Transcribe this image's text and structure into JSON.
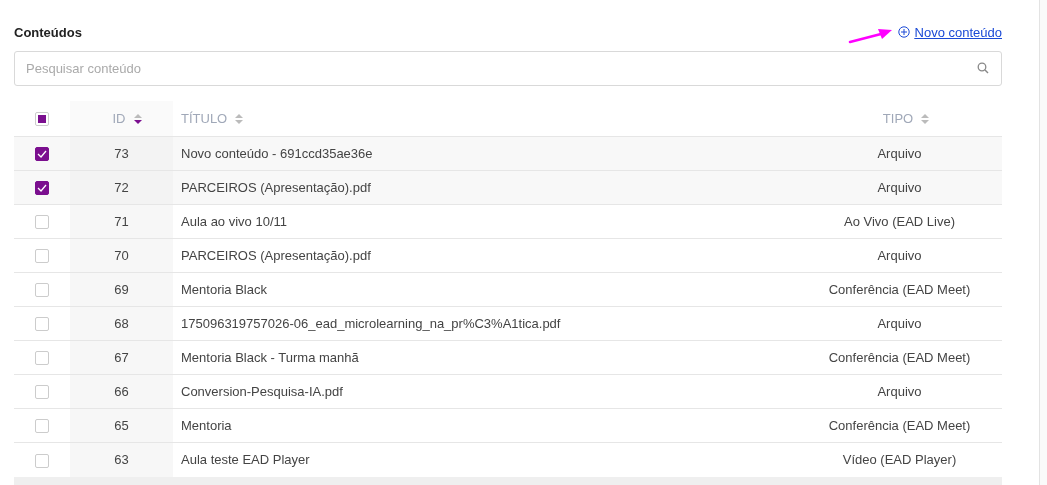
{
  "title": "Conteúdos",
  "new_link": {
    "label": "Novo conteúdo"
  },
  "search": {
    "placeholder": "Pesquisar conteúdo"
  },
  "table": {
    "select_all": {
      "partial": true
    },
    "columns": [
      {
        "label": "ID",
        "sorted": true,
        "descending": true
      },
      {
        "label": "TÍTULO",
        "sorted": false
      },
      {
        "label": "TIPO",
        "sorted": false
      }
    ],
    "rows": [
      {
        "id": "73",
        "title": "Novo conteúdo - 691ccd35ae36e",
        "type": "Arquivo",
        "checked": true
      },
      {
        "id": "72",
        "title": "PARCEIROS (Apresentação).pdf",
        "type": "Arquivo",
        "checked": true
      },
      {
        "id": "71",
        "title": "Aula ao vivo 10/11",
        "type": "Ao Vivo (EAD Live)",
        "checked": false
      },
      {
        "id": "70",
        "title": "PARCEIROS (Apresentação).pdf",
        "type": "Arquivo",
        "checked": false
      },
      {
        "id": "69",
        "title": "Mentoria Black",
        "type": "Conferência (EAD Meet)",
        "checked": false
      },
      {
        "id": "68",
        "title": "175096319757026-06_ead_microlearning_na_pr%C3%A1tica.pdf",
        "type": "Arquivo",
        "checked": false
      },
      {
        "id": "67",
        "title": "Mentoria Black - Turma manhã",
        "type": "Conferência (EAD Meet)",
        "checked": false
      },
      {
        "id": "66",
        "title": "Conversion-Pesquisa-IA.pdf",
        "type": "Arquivo",
        "checked": false
      },
      {
        "id": "65",
        "title": "Mentoria",
        "type": "Conferência (EAD Meet)",
        "checked": false
      },
      {
        "id": "63",
        "title": "Aula teste EAD Player",
        "type": "Vídeo (EAD Player)",
        "checked": false
      }
    ]
  }
}
